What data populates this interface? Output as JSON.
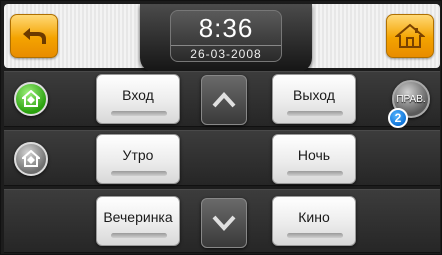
{
  "header": {
    "time": "8:36",
    "date": "26-03-2008"
  },
  "scenes": {
    "vhod": "Вход",
    "vyhod": "Выход",
    "utro": "Утро",
    "noch": "Ночь",
    "vecherinka": "Вечеринка",
    "kino": "Кино"
  },
  "rules_button": {
    "label": "ПРАВ.",
    "badge_count": "2"
  },
  "icons": {
    "back": "back-arrow-icon",
    "home": "home-icon",
    "up": "arrow-up-icon",
    "down": "arrow-down-icon",
    "home_status_active": "home-shield-icon",
    "home_status_inactive": "home-shield-icon"
  },
  "colors": {
    "accent_orange": "#f4a300",
    "active_green": "#2aa10e",
    "badge_blue": "#0a6fd6"
  }
}
